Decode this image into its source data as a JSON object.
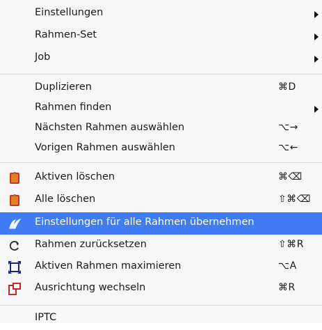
{
  "menu": {
    "items": [
      {
        "label": "Einstellungen",
        "shortcut": "",
        "submenu": true
      },
      {
        "label": "Rahmen-Set",
        "shortcut": "",
        "submenu": true
      },
      {
        "label": "Job",
        "shortcut": "",
        "submenu": true
      },
      {
        "label": "Duplizieren",
        "shortcut": "⌘D",
        "submenu": false
      },
      {
        "label": "Rahmen finden",
        "shortcut": "",
        "submenu": true
      },
      {
        "label": "Nächsten Rahmen auswählen",
        "shortcut": "⌥→",
        "submenu": false
      },
      {
        "label": "Vorigen Rahmen auswählen",
        "shortcut": "⌥←",
        "submenu": false
      },
      {
        "label": "Aktiven löschen",
        "shortcut": "⌘⌫",
        "icon": "delete-active-icon"
      },
      {
        "label": "Alle löschen",
        "shortcut": "⇧⌘⌫",
        "icon": "delete-all-icon"
      },
      {
        "label": "Einstellungen für alle Rahmen übernehmen",
        "shortcut": "",
        "icon": "apply-settings-all-icon",
        "selected": true
      },
      {
        "label": "Rahmen zurücksetzen",
        "shortcut": "⇧⌘R",
        "icon": "reset-frame-icon"
      },
      {
        "label": "Aktiven Rahmen maximieren",
        "shortcut": "⌥A",
        "icon": "maximize-frame-icon"
      },
      {
        "label": "Ausrichtung wechseln",
        "shortcut": "⌘R",
        "icon": "switch-orientation-icon"
      },
      {
        "label": "IPTC",
        "shortcut": ""
      }
    ]
  },
  "colors": {
    "highlight": "#3f7cf3",
    "menu_bg": "#f7f7f7",
    "separator": "#d9d9d9"
  }
}
